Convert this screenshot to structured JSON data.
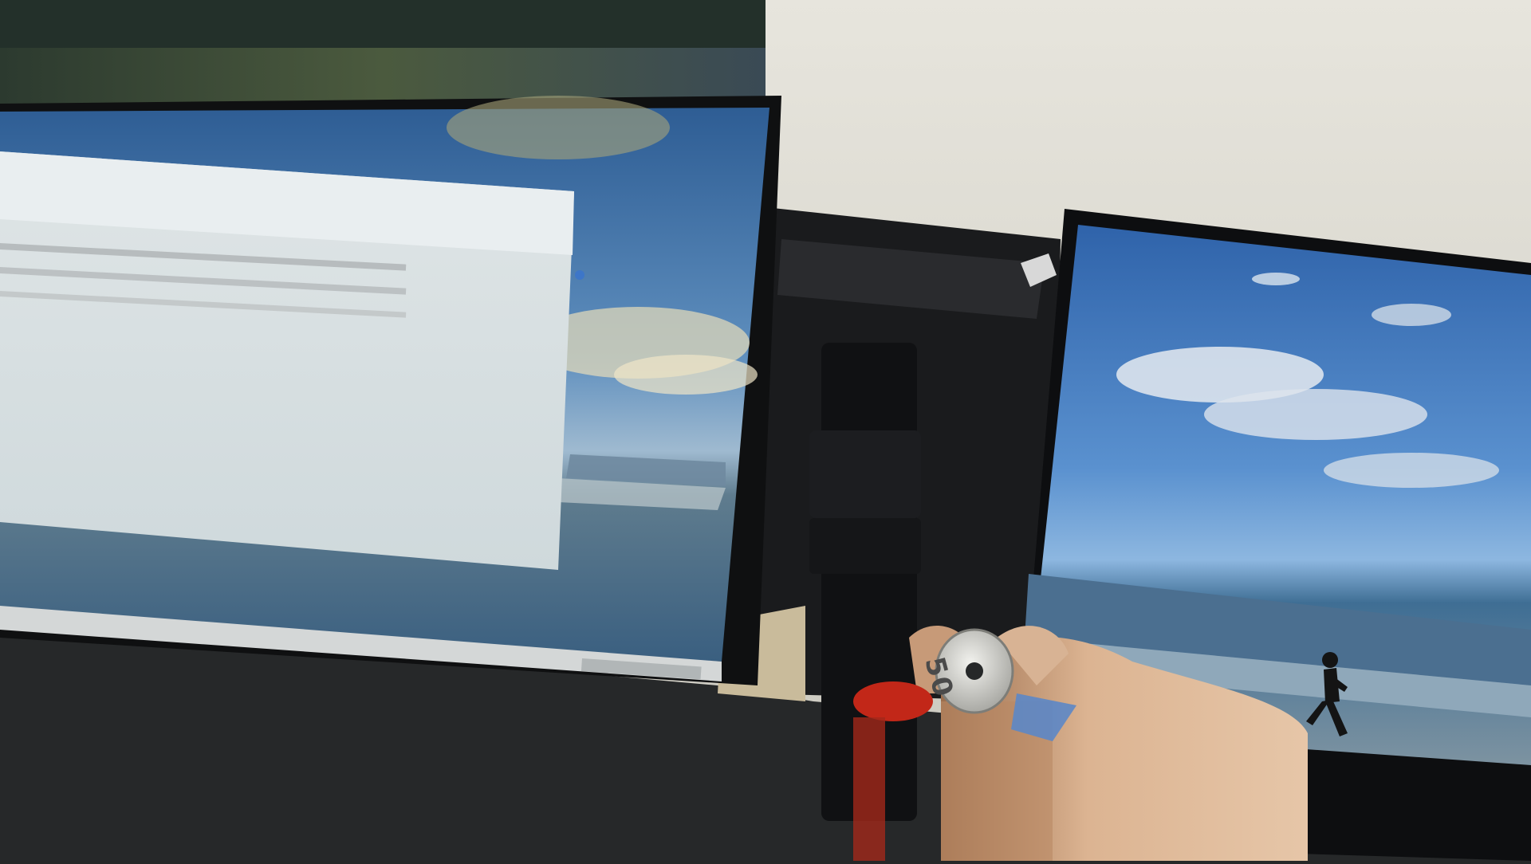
{
  "scene": {
    "description_label": "photo",
    "coin_text": "50",
    "colors": {
      "wall": "#d9d8d0",
      "monitor_bezel": "#151618",
      "desk_dark": "#25272a",
      "sky_deep": "#2f64a8",
      "sky_light": "#7eb0dc",
      "sea": "#4f7898",
      "sand": "#b7b09a",
      "window_bg": "#e6ecef",
      "skin": "#d7b291",
      "coin": "#c9c9c4"
    },
    "icons": [
      "monitor-stand",
      "coin",
      "hand",
      "runner-silhouette"
    ]
  }
}
